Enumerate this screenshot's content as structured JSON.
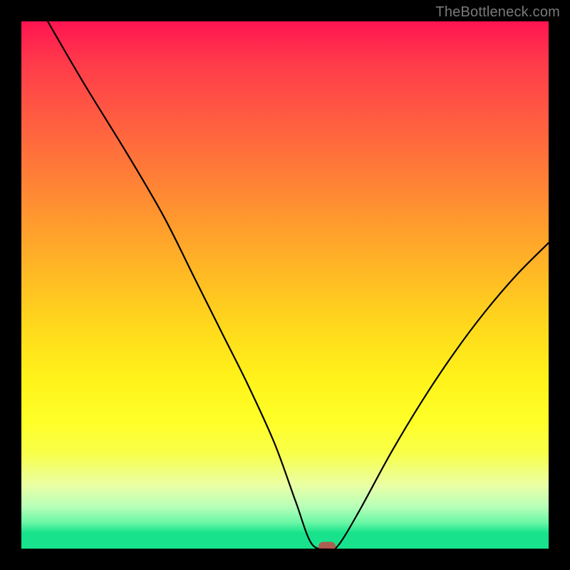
{
  "watermark": "TheBottleneck.com",
  "chart_data": {
    "type": "line",
    "title": "",
    "xlabel": "",
    "ylabel": "",
    "xlim": [
      0,
      100
    ],
    "ylim": [
      0,
      100
    ],
    "gradient_axis": "y",
    "gradient_meaning": "bottleneck-severity: green=good at bottom, red=bad at top",
    "marker": {
      "x": 58,
      "y": 0
    },
    "curve_points": [
      {
        "x": 5,
        "y": 100
      },
      {
        "x": 12,
        "y": 88
      },
      {
        "x": 20,
        "y": 75
      },
      {
        "x": 27,
        "y": 63
      },
      {
        "x": 33,
        "y": 51
      },
      {
        "x": 38,
        "y": 41
      },
      {
        "x": 43,
        "y": 31
      },
      {
        "x": 48,
        "y": 20
      },
      {
        "x": 52,
        "y": 9
      },
      {
        "x": 55,
        "y": 1
      },
      {
        "x": 58,
        "y": 0
      },
      {
        "x": 60,
        "y": 0.5
      },
      {
        "x": 64,
        "y": 7
      },
      {
        "x": 70,
        "y": 18
      },
      {
        "x": 76,
        "y": 28
      },
      {
        "x": 82,
        "y": 37
      },
      {
        "x": 88,
        "y": 45
      },
      {
        "x": 94,
        "y": 52
      },
      {
        "x": 100,
        "y": 58
      }
    ]
  }
}
